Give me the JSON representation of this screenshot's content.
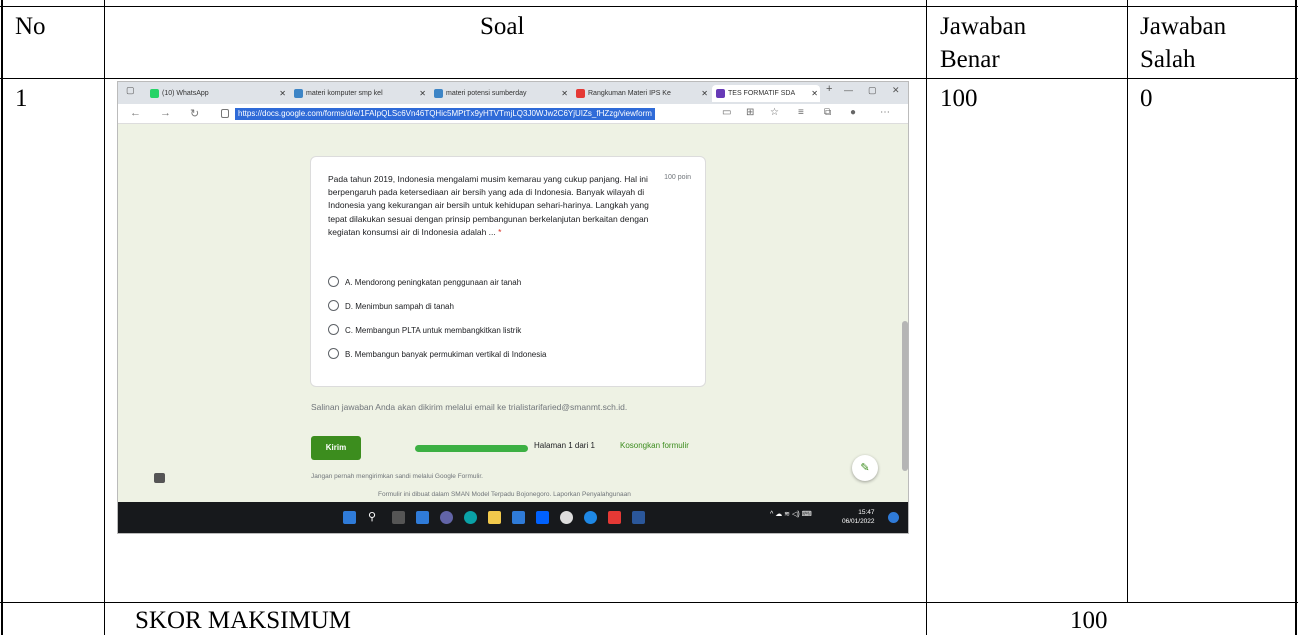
{
  "table": {
    "headers": {
      "no": "No",
      "soal": "Soal",
      "jawaban_benar": "Jawaban Benar",
      "jawaban_benar_l1": "Jawaban",
      "jawaban_benar_l2": "Benar",
      "jawaban_salah_l1": "Jawaban",
      "jawaban_salah_l2": "Salah"
    },
    "rows": [
      {
        "no": "1",
        "jawaban_benar": "100",
        "jawaban_salah": "0"
      }
    ],
    "footer": {
      "label": "SKOR MAKSIMUM",
      "value": "100"
    }
  },
  "screenshot": {
    "tabs": [
      {
        "label": "(10) WhatsApp",
        "color": "#25d366"
      },
      {
        "label": "materi komputer smp kel",
        "color": "#3d85c6"
      },
      {
        "label": "materi potensi sumberday",
        "color": "#3d85c6"
      },
      {
        "label": "Rangkuman Materi IPS Ke",
        "color": "#e53935"
      },
      {
        "label": "TES FORMATIF SDA",
        "color": "#673ab7"
      }
    ],
    "url": "https://docs.google.com/forms/d/e/1FAIpQLSc6Vn46TQHic5MPtTx9yHTVTmjLQ3J0WJw2C6YjUIZs_fHZzg/viewform",
    "question": {
      "text": "Pada tahun 2019, Indonesia mengalami musim kemarau yang cukup panjang. Hal ini berpengaruh pada ketersediaan air bersih yang ada di Indonesia. Banyak wilayah di Indonesia yang kekurangan air bersih untuk kehidupan sehari-harinya. Langkah yang tepat dilakukan sesuai dengan prinsip pembangunan berkelanjutan berkaitan dengan kegiatan konsumsi air di Indonesia adalah ...",
      "required_mark": "*",
      "points": "100 poin",
      "options": [
        "A. Mendorong peningkatan penggunaan air tanah",
        "D. Menimbun sampah di tanah",
        "C. Membangun PLTA untuk membangkitkan listrik",
        "B. Membangun banyak permukiman vertikal di Indonesia"
      ]
    },
    "email_notice": "Salinan jawaban Anda akan dikirim melalui email ke trialistarifaried@smanmt.sch.id.",
    "submit_label": "Kirim",
    "progress": 1.0,
    "page_label": "Halaman 1 dari 1",
    "clear_label": "Kosongkan formulir",
    "warning": "Jangan pernah mengirimkan sandi melalui Google Formulir.",
    "footer_partial": "Formulir ini dibuat dalam SMAN Model Terpadu Bojonegoro. Laporkan Penyalahgunaan",
    "time": "15:47",
    "date": "06/01/2022",
    "accent": "#3c8d1e"
  }
}
